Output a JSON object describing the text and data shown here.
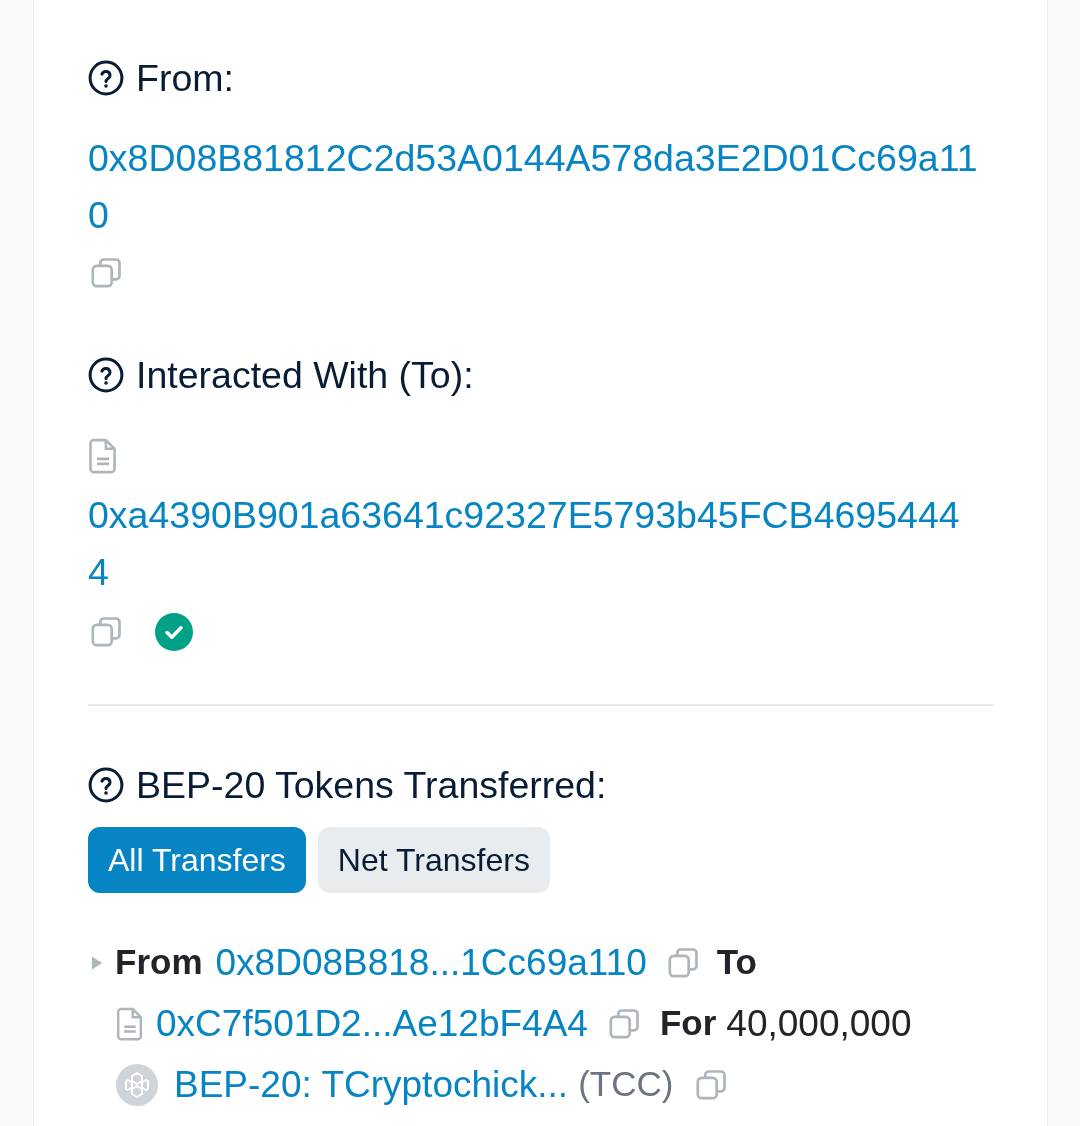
{
  "fields": [
    {
      "label": "From:",
      "address": "0x8D08B81812C2d53A0144A578da3E2D01Cc69a110",
      "contract": false,
      "verified": false
    },
    {
      "label": "Interacted With (To):",
      "address": "0xa4390B901a63641c92327E5793b45FCB46954444",
      "contract": true,
      "verified": true
    }
  ],
  "token_transfers": {
    "label": "BEP-20 Tokens Transferred:",
    "tabs": [
      {
        "label": "All Transfers",
        "selected": true
      },
      {
        "label": "Net Transfers",
        "selected": false
      }
    ],
    "rows": [
      {
        "expanded": false,
        "from_label": "From",
        "from": "0x8D08B818...1Cc69a110",
        "to_label": "To",
        "to": "0xC7f501D2...Ae12bF4A4",
        "to_contract": true,
        "for_label": "For",
        "amount": "40,000,000",
        "token": "BEP-20: TCryptochick...",
        "symbol": "(TCC)"
      }
    ]
  }
}
